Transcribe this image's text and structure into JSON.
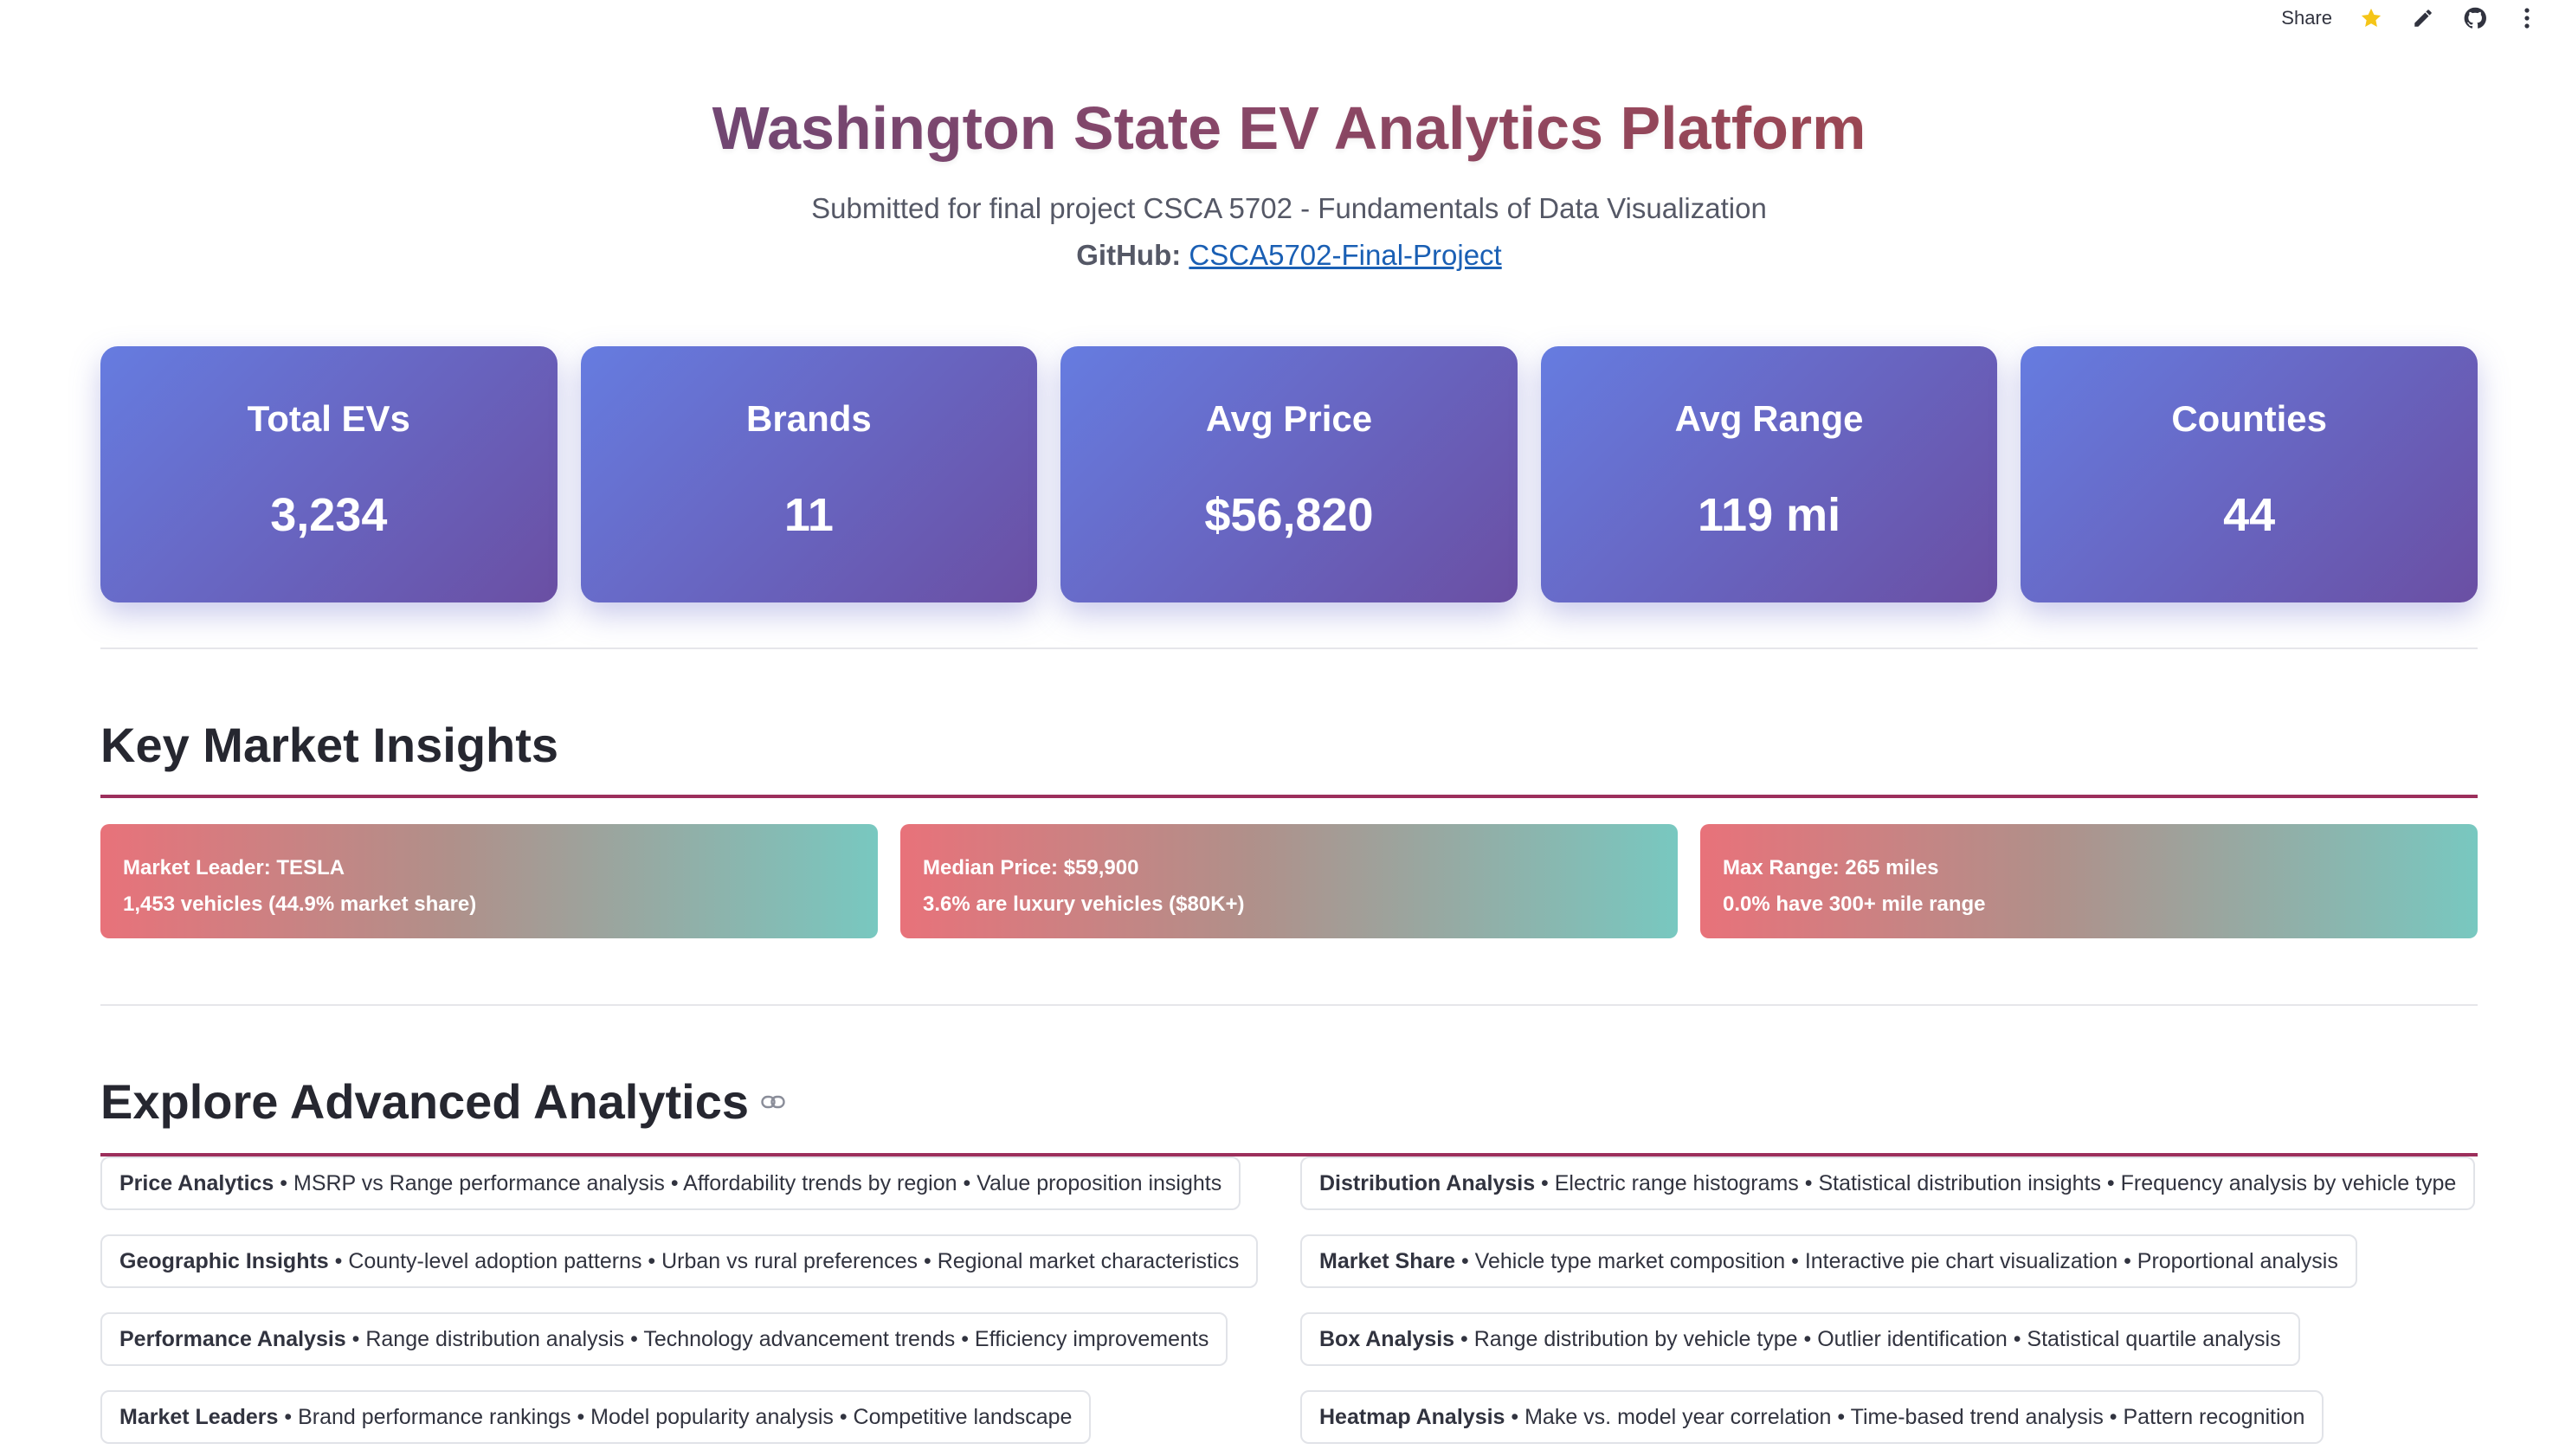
{
  "toolbar": {
    "share_label": "Share",
    "icons": [
      "star-icon",
      "edit-icon",
      "github-icon",
      "more-menu-icon"
    ]
  },
  "header": {
    "title": "Washington State EV Analytics Platform",
    "subtitle": "Submitted for final project CSCA 5702 - Fundamentals of Data Visualization",
    "github_label": "GitHub:",
    "github_link_text": "CSCA5702-Final-Project"
  },
  "metrics": [
    {
      "label": "Total EVs",
      "value": "3,234"
    },
    {
      "label": "Brands",
      "value": "11"
    },
    {
      "label": "Avg Price",
      "value": "$56,820"
    },
    {
      "label": "Avg Range",
      "value": "119 mi"
    },
    {
      "label": "Counties",
      "value": "44"
    }
  ],
  "insights_section": {
    "heading": "Key Market Insights",
    "cards": [
      {
        "line1": "Market Leader: TESLA",
        "line2": "1,453 vehicles (44.9% market share)"
      },
      {
        "line1": "Median Price: $59,900",
        "line2": "3.6% are luxury vehicles ($80K+)"
      },
      {
        "line1": "Max Range: 265 miles",
        "line2": "0.0% have 300+ mile range"
      }
    ]
  },
  "explore_section": {
    "heading": "Explore Advanced Analytics",
    "left": [
      {
        "title": "Price Analytics",
        "desc": " • MSRP vs Range performance analysis • Affordability trends by region • Value proposition insights"
      },
      {
        "title": "Geographic Insights",
        "desc": " • County-level adoption patterns • Urban vs rural preferences • Regional market characteristics"
      },
      {
        "title": "Performance Analysis",
        "desc": " • Range distribution analysis • Technology advancement trends • Efficiency improvements"
      },
      {
        "title": "Market Leaders",
        "desc": " • Brand performance rankings • Model popularity analysis • Competitive landscape"
      }
    ],
    "right": [
      {
        "title": "Distribution Analysis",
        "desc": " • Electric range histograms • Statistical distribution insights • Frequency analysis by vehicle type"
      },
      {
        "title": "Market Share",
        "desc": " • Vehicle type market composition • Interactive pie chart visualization • Proportional analysis"
      },
      {
        "title": "Box Analysis",
        "desc": " • Range distribution by vehicle type • Outlier identification • Statistical quartile analysis"
      },
      {
        "title": "Heatmap Analysis",
        "desc": " • Make vs. model year correlation • Time-based trend analysis • Pattern recognition"
      }
    ]
  },
  "colors": {
    "metric_gradient_start": "#667ce0",
    "metric_gradient_end": "#6a4fa3",
    "insight_gradient_start": "#e8727a",
    "insight_gradient_end": "#78c8c0",
    "section_rule": "#9c2f5c",
    "link": "#1a5fb4",
    "star": "#f5c518"
  }
}
